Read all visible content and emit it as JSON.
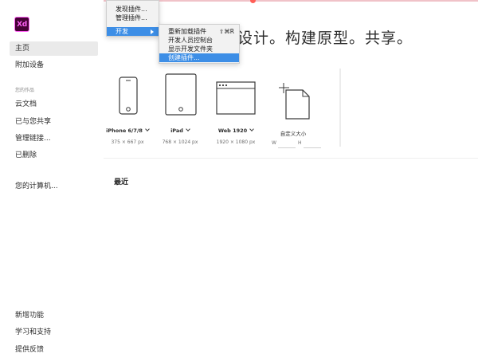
{
  "app": {
    "logo_text": "Xd",
    "brand_color": "#470137",
    "accent_color": "#ff61f6"
  },
  "sidebar": {
    "top_items": [
      {
        "label": "主页",
        "active": true
      },
      {
        "label": "附加设备",
        "active": false
      }
    ],
    "section_title": "您的作品",
    "work_items": [
      {
        "label": "云文档"
      },
      {
        "label": "已与您共享"
      },
      {
        "label": "管理链接..."
      },
      {
        "label": "已删除"
      }
    ],
    "computer_item": "您的计算机...",
    "bottom_items": [
      {
        "label": "新增功能"
      },
      {
        "label": "学习和支持"
      },
      {
        "label": "提供反馈"
      }
    ]
  },
  "main": {
    "hero_text": "设计。构建原型。共享。",
    "templates": [
      {
        "name": "iPhone 6/7/8",
        "size": "375 × 667 px",
        "icon": "phone-icon"
      },
      {
        "name": "iPad",
        "size": "768 × 1024 px",
        "icon": "tablet-icon"
      },
      {
        "name": "Web 1920",
        "size": "1920 × 1080 px",
        "icon": "browser-window-icon"
      },
      {
        "name": "自定义大小",
        "width_label": "W",
        "height_label": "H",
        "icon": "custom-document-icon"
      }
    ],
    "recent_title": "最近"
  },
  "plugins_menu": {
    "items": [
      {
        "label": "发现插件..."
      },
      {
        "label": "管理插件..."
      },
      {
        "label": "开发",
        "highlighted": true,
        "has_submenu": true
      }
    ]
  },
  "develop_submenu": {
    "items": [
      {
        "label": "重新加载插件",
        "shortcut": "⇧⌘R"
      },
      {
        "label": "开发人员控制台"
      },
      {
        "label": "显示开发文件夹"
      },
      {
        "label": "创建插件...",
        "highlighted": true
      }
    ]
  },
  "menu_highlight_color": "#3d8ee6"
}
